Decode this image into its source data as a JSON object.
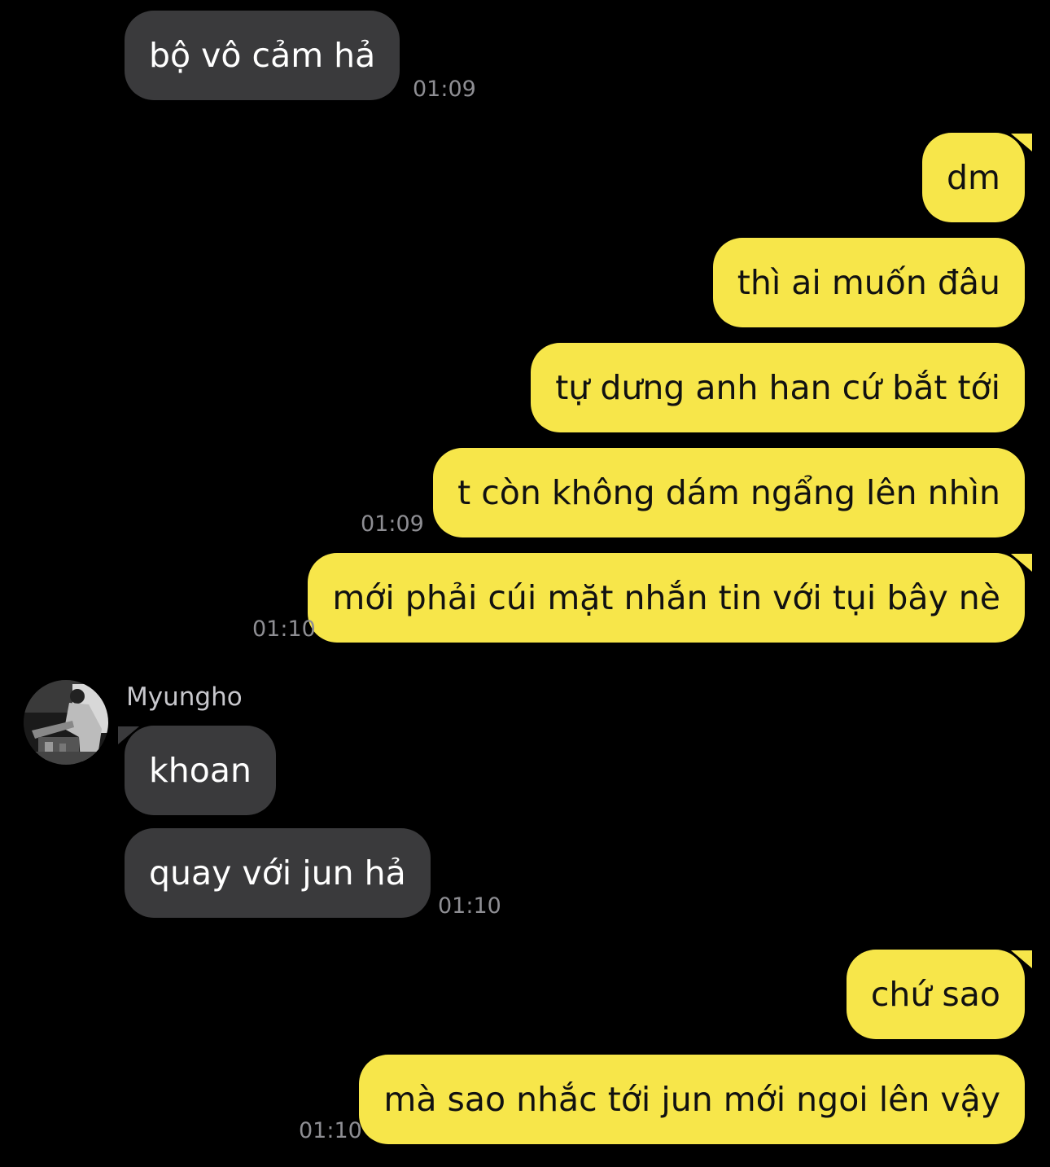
{
  "colors": {
    "background": "#000000",
    "incoming_bubble": "#3a3a3c",
    "outgoing_bubble": "#f7e64a",
    "timestamp": "#8e8e93"
  },
  "contact": {
    "name": "Myungho",
    "avatar_icon": "profile-photo-avatar"
  },
  "messages": [
    {
      "direction": "in",
      "text": "bộ vô cảm hả",
      "time": "01:09"
    },
    {
      "direction": "out",
      "text": "dm",
      "time": ""
    },
    {
      "direction": "out",
      "text": "thì ai muốn đâu",
      "time": ""
    },
    {
      "direction": "out",
      "text": "tự dưng anh han cứ bắt tới",
      "time": ""
    },
    {
      "direction": "out",
      "text": "t còn không dám ngẩng lên nhìn",
      "time": "01:09"
    },
    {
      "direction": "out",
      "text": "mới phải cúi mặt nhắn tin với tụi bây nè",
      "time": "01:10"
    },
    {
      "direction": "in",
      "text": "khoan",
      "time": ""
    },
    {
      "direction": "in",
      "text": "quay với jun hả",
      "time": "01:10"
    },
    {
      "direction": "out",
      "text": "chứ sao",
      "time": ""
    },
    {
      "direction": "out",
      "text": "mà sao nhắc tới jun mới ngoi lên vậy",
      "time": "01:10"
    }
  ]
}
